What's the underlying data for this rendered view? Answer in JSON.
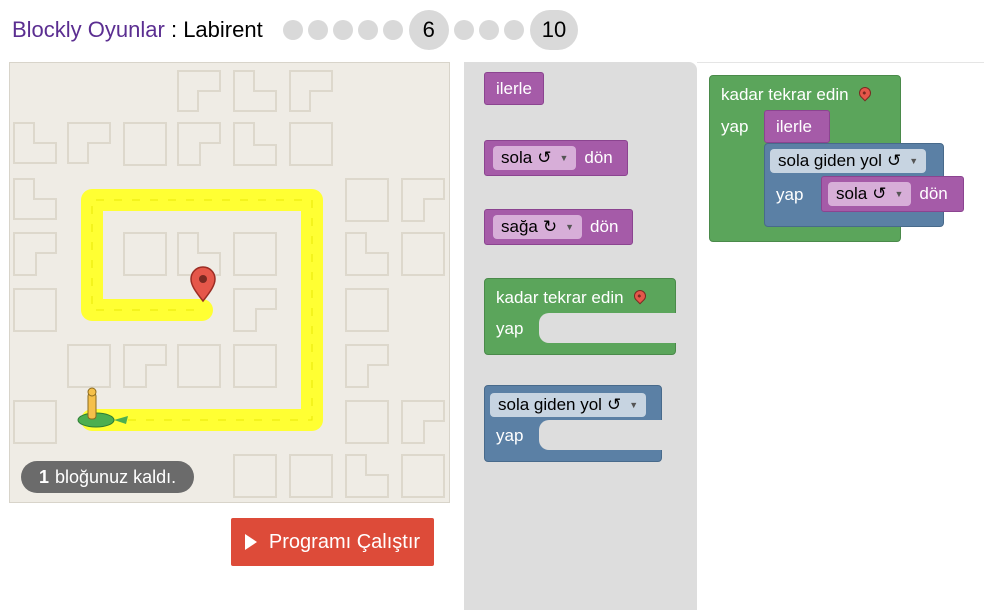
{
  "header": {
    "app_name": "Blockly Oyunlar",
    "separator": " : ",
    "game_name": "Labirent",
    "levels": [
      "1",
      "2",
      "3",
      "4",
      "5",
      "6",
      "7",
      "8",
      "9",
      "10"
    ],
    "current_level": "6",
    "last_level": "10"
  },
  "maze": {
    "remaining_count": "1",
    "remaining_text": "bloğunuz kaldı."
  },
  "run_button": {
    "label": "Programı Çalıştır"
  },
  "toolbox": {
    "move_forward": "ilerle",
    "turn_left": {
      "dropdown": "sola",
      "rotate_symbol": "↺",
      "suffix": "dön"
    },
    "turn_right": {
      "dropdown": "sağa",
      "rotate_symbol": "↻",
      "suffix": "dön"
    },
    "repeat_until": {
      "label": "kadar tekrar edin",
      "do": "yap"
    },
    "if_path": {
      "dropdown": "sola giden yol",
      "rotate_symbol": "↺",
      "do": "yap"
    }
  },
  "workspace": {
    "repeat_until": {
      "label": "kadar tekrar edin",
      "do": "yap"
    },
    "move_forward": "ilerle",
    "if_path": {
      "dropdown": "sola giden yol",
      "rotate_symbol": "↺",
      "do": "yap"
    },
    "turn": {
      "dropdown": "sola",
      "rotate_symbol": "↺",
      "suffix": "dön"
    }
  },
  "colors": {
    "app_name": "#5b2e91",
    "path": "#ffff00",
    "move_block": "#a55ba8",
    "loop_block": "#5ba55b",
    "logic_block": "#5b80a5",
    "run_button": "#dd4b39"
  }
}
